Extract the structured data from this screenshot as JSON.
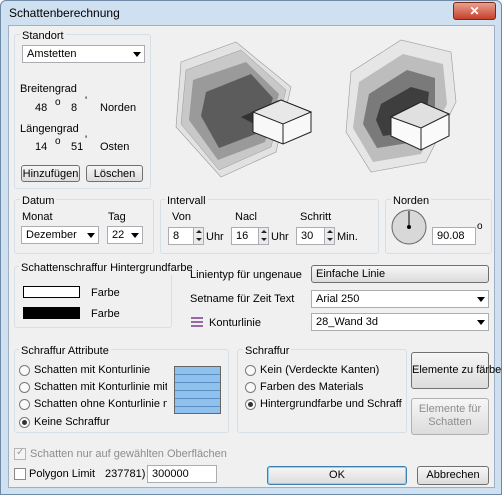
{
  "window": {
    "title": "Schattenberechnung",
    "close": "✕"
  },
  "standort": {
    "group_label": "Standort",
    "selected": "Amstetten",
    "breitengrad_label": "Breitengrad",
    "lat_deg": "48",
    "lat_min": "8",
    "lat_dir": "Norden",
    "laengengrad_label": "Längengrad",
    "lon_deg": "14",
    "lon_min": "51",
    "lon_dir": "Osten",
    "deg_sym": "o",
    "min_sym": "'",
    "add_button": "Hinzufügen",
    "delete_button": "Löschen"
  },
  "datum": {
    "group_label": "Datum",
    "monat_label": "Monat",
    "monat_value": "Dezember",
    "tag_label": "Tag",
    "tag_value": "22"
  },
  "intervall": {
    "group_label": "Intervall",
    "von_label": "Von",
    "von_value": "8",
    "nach_label": "Nacl",
    "nach_value": "16",
    "schritt_label": "Schritt",
    "schritt_value": "30",
    "uhr1": "Uhr",
    "uhr2": "Uhr",
    "min": "Min."
  },
  "norden": {
    "group_label": "Norden",
    "value": "90.08",
    "deg_sym": "o"
  },
  "hintergrund": {
    "group_label": "Schattenschraffur Hintergrundfarbe",
    "farbe1": "Farbe",
    "farbe2": "Farbe",
    "color_white": "#ffffff",
    "color_black": "#000000"
  },
  "linien": {
    "label": "Linientyp für ungenaue",
    "value": "Einfache Linie"
  },
  "setname": {
    "label": "Setname für Zeit Text",
    "value": "Arial 250"
  },
  "kontur": {
    "label": "Konturlinie",
    "value": "28_Wand 3d"
  },
  "schraffur_attribute": {
    "group_label": "Schraffur Attribute",
    "options": [
      "Schatten mit Konturlinie",
      "Schatten mit Konturlinie mit Schraffur",
      "Schatten ohne Konturlinie mit Schraffur",
      "Keine Schraffur"
    ],
    "selected_index": 3
  },
  "schraffur": {
    "group_label": "Schraffur",
    "options": [
      "Kein (Verdeckte Kanten)",
      "Farben des Materials",
      "Hintergrundfarbe und Schraffur des Materials"
    ],
    "selected_index": 2,
    "elemente_faerben": "Elemente zu färben",
    "elemente_schatten": "Elemente für\nSchatten"
  },
  "footer": {
    "only_selected_label": "Schatten nur auf gewählten Oberflächen",
    "polygon_label": "Polygon Limit",
    "polygon_hint": "237781)",
    "polygon_value": "300000",
    "ok": "OK",
    "cancel": "Abbrechen"
  }
}
